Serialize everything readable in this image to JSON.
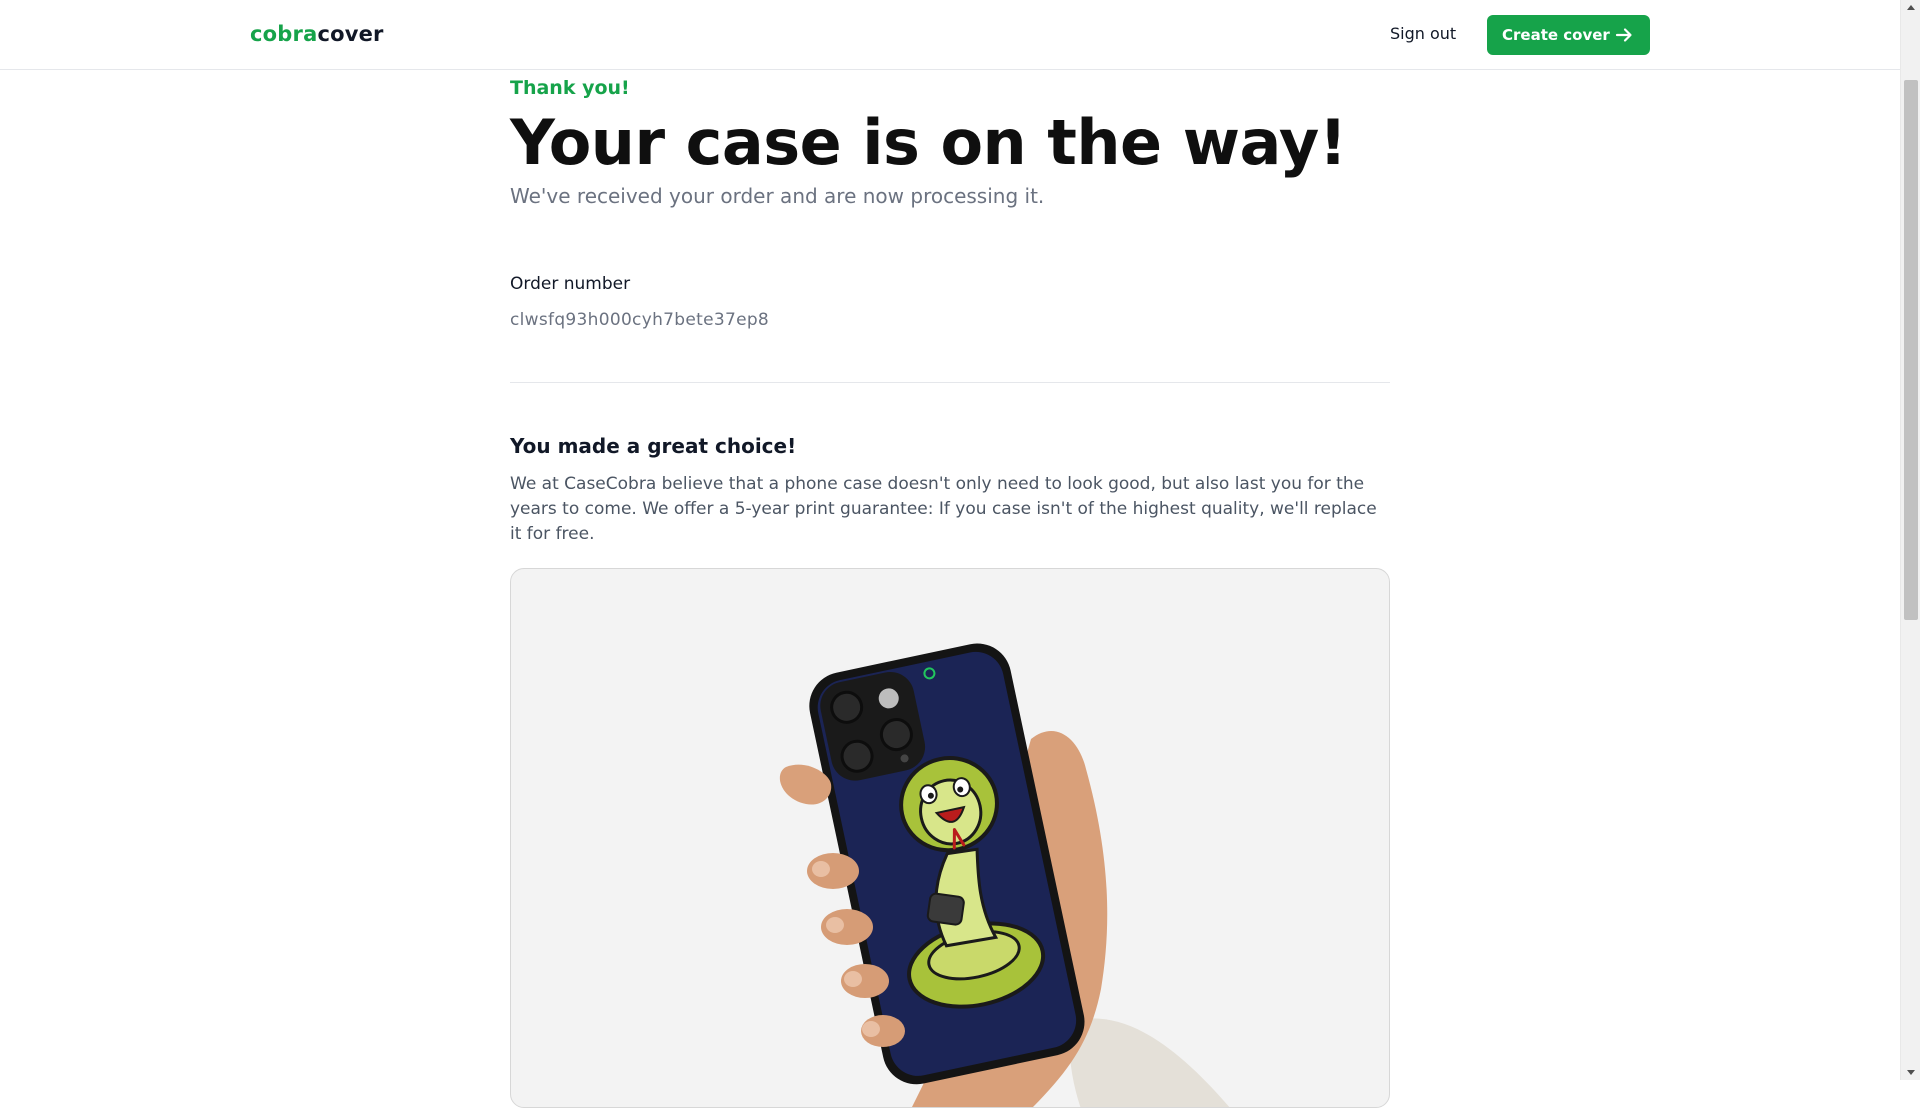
{
  "navbar": {
    "logo_part1": "cobra",
    "logo_part2": "cover",
    "signout_label": "Sign out",
    "create_label": "Create cover",
    "create_icon": "arrow-right-icon"
  },
  "main": {
    "thank_you": "Thank you!",
    "headline": "Your case is on the way!",
    "subtitle": "We've received your order and are now processing it.",
    "order_label": "Order number",
    "order_number": "clwsfq93h000cyh7bete37ep8",
    "choice_title": "You made a great choice!",
    "choice_text": "We at CaseCobra believe that a phone case doesn't only need to look good, but also last you for the years to come. We offer a 5-year print guarantee: If you case isn't of the highest quality, we'll replace it for free."
  },
  "colors": {
    "accent": "#16a34a",
    "case_print": "#1b2455",
    "snake": "#a8c23a"
  }
}
